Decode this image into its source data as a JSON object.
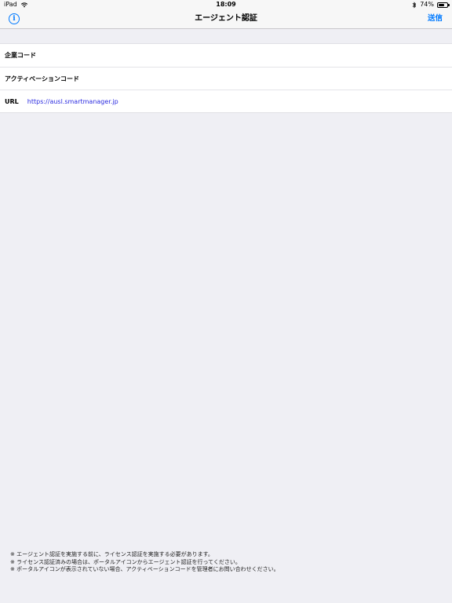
{
  "status_bar": {
    "device": "iPad",
    "time": "18:09",
    "battery_percent": "74%",
    "battery_level": 0.74
  },
  "nav_bar": {
    "title": "エージェント認証",
    "send_label": "送信",
    "info_glyph": "i"
  },
  "form": {
    "company_code_label": "企業コード",
    "company_code_value": "",
    "activation_code_label": "アクティベーションコード",
    "activation_code_value": "",
    "url_label": "URL",
    "url_value": "https://ausl.smartmanager.jp"
  },
  "notes": [
    "※ エージェント認証を実施する前に、ライセンス認証を実施する必要があります。",
    "※ ライセンス認証済みの場合は、ポータルアイコンからエージェント認証を行ってください。",
    "※ ポータルアイコンが表示されていない場合、アクティベーションコードを管理者にお問い合わせください。"
  ],
  "colors": {
    "accent": "#007aff",
    "background": "#efeff4",
    "link": "#2a2ae0"
  },
  "icons": {
    "info": "info-circle-icon",
    "wifi": "wifi-icon",
    "bluetooth": "bluetooth-icon",
    "battery": "battery-icon"
  }
}
